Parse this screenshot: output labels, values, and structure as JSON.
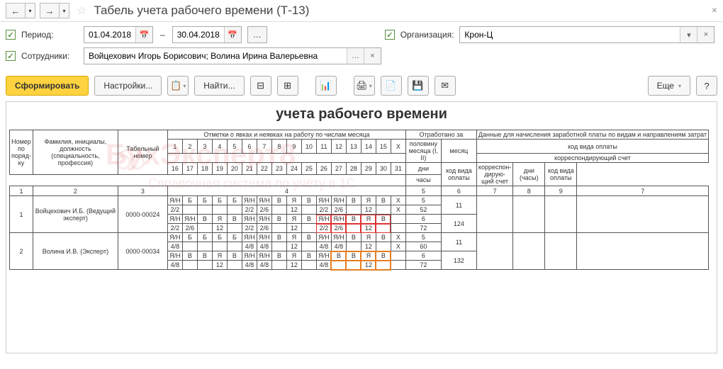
{
  "title": "Табель учета рабочего времени (Т-13)",
  "params": {
    "period_label": "Период:",
    "date_from": "01.04.2018",
    "date_to": "30.04.2018",
    "org_label": "Организация:",
    "org_value": "Крон-Ц",
    "emp_label": "Сотрудники:",
    "emp_value": "Войцехович Игорь Борисович; Волина Ирина Валерьевна"
  },
  "toolbar": {
    "form": "Сформировать",
    "settings": "Настройки...",
    "find": "Найти...",
    "more": "Еще"
  },
  "doc": {
    "heading": "учета  рабочего времени",
    "watermark1": "БухЭксперт8",
    "watermark2": "Справочная система по учёту в 1С",
    "header": {
      "num": "Номер по поряд-ку",
      "fio": "Фамилия, инициалы, должность (специальность, профессия)",
      "tabnum": "Табельный номер",
      "marks": "Отметки о явках и неявках на работу по числам месяца",
      "worked": "Отработано за",
      "half": "половину месяца (I, II)",
      "month": "месяц",
      "days": "дни",
      "hours": "часы",
      "pay_data": "Данные для начисления заработной платы по видам и направлениям затрат",
      "pay_code_top": "код вида оплаты",
      "corr_top": "корреспондирующий счет",
      "pay_code": "код вида оплаты",
      "corr": "корреспон-дирую-щий счет",
      "days_hours": "дни (часы)",
      "pay_code2": "код вида оплаты"
    },
    "day_nums_top": [
      "1",
      "2",
      "3",
      "4",
      "5",
      "6",
      "7",
      "8",
      "9",
      "10",
      "11",
      "12",
      "13",
      "14",
      "15",
      "X"
    ],
    "day_nums_bot": [
      "16",
      "17",
      "18",
      "19",
      "20",
      "21",
      "22",
      "23",
      "24",
      "25",
      "26",
      "27",
      "28",
      "29",
      "30",
      "31"
    ],
    "col_nums": {
      "c1": "1",
      "c2": "2",
      "c3": "3",
      "c4": "4",
      "c5": "5",
      "c6": "6",
      "c7": "7",
      "c8": "8",
      "c9": "9",
      "c7b": "7"
    },
    "rows": [
      {
        "num": "1",
        "name": "Войцехович И.Б. (Ведущий эксперт)",
        "tabnum": "0000-00024",
        "half_days": [
          "5",
          "6"
        ],
        "half_hours": [
          "52",
          "72"
        ],
        "month_days": "11",
        "month_hours": "124",
        "r1": [
          "Я/Н",
          "Б",
          "Б",
          "Б",
          "Б",
          "Я/Н",
          "Я/Н",
          "В",
          "Я",
          "В",
          "Я/Н",
          "Я/Н",
          "В",
          "Я",
          "В",
          "X"
        ],
        "r2": [
          "2/2",
          "",
          "",
          "",
          "",
          "2/2",
          "2/6",
          "",
          "12",
          "",
          "2/2",
          "2/6",
          "",
          "12",
          "",
          "X"
        ],
        "r3": [
          "Я/Н",
          "Я/Н",
          "В",
          "Я",
          "В",
          "Я/Н",
          "Я/Н",
          "В",
          "Я",
          "В",
          "Я/Н",
          "Я/Н",
          "В",
          "Я",
          "В",
          ""
        ],
        "r4": [
          "2/2",
          "2/6",
          "",
          "12",
          "",
          "2/2",
          "2/6",
          "",
          "12",
          "",
          "2/2",
          "2/6",
          "",
          "12",
          "",
          ""
        ]
      },
      {
        "num": "2",
        "name": "Волина И.В. (Эксперт)",
        "tabnum": "0000-00034",
        "half_days": [
          "5",
          "6"
        ],
        "half_hours": [
          "60",
          "72"
        ],
        "month_days": "11",
        "month_hours": "132",
        "r1": [
          "Я/Н",
          "Б",
          "Б",
          "Б",
          "Б",
          "Я/Н",
          "Я/Н",
          "В",
          "Я",
          "В",
          "Я/Н",
          "Я/Н",
          "В",
          "Я",
          "В",
          "X"
        ],
        "r2": [
          "4/8",
          "",
          "",
          "",
          "",
          "4/8",
          "4/8",
          "",
          "12",
          "",
          "4/8",
          "4/8",
          "",
          "12",
          "",
          "X"
        ],
        "r3": [
          "Я/Н",
          "В",
          "В",
          "Я",
          "В",
          "Я/Н",
          "Я/Н",
          "В",
          "Я",
          "В",
          "Я/Н",
          "В",
          "В",
          "Я",
          "В",
          ""
        ],
        "r4": [
          "4/8",
          "",
          "",
          "12",
          "",
          "4/8",
          "4/8",
          "",
          "12",
          "",
          "4/8",
          "",
          "",
          "12",
          "",
          ""
        ]
      }
    ]
  }
}
